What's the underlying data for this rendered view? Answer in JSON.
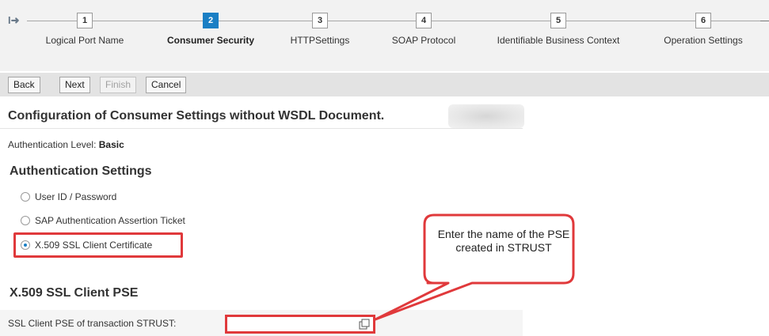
{
  "roadmap": {
    "steps": [
      {
        "number": "1",
        "label": "Logical Port Name",
        "active": false
      },
      {
        "number": "2",
        "label": "Consumer Security",
        "active": true
      },
      {
        "number": "3",
        "label": "HTTPSettings",
        "active": false
      },
      {
        "number": "4",
        "label": "SOAP Protocol",
        "active": false
      },
      {
        "number": "5",
        "label": "Identifiable Business Context",
        "active": false
      },
      {
        "number": "6",
        "label": "Operation Settings",
        "active": false
      }
    ],
    "start_icon": "roadmap-start-icon",
    "active_color": "#1a7fc4"
  },
  "toolbar": {
    "back_label": "Back",
    "next_label": "Next",
    "finish_label": "Finish",
    "cancel_label": "Cancel"
  },
  "main": {
    "title": "Configuration of Consumer Settings without WSDL Document.",
    "auth_level_label": "Authentication Level:",
    "auth_level_value": "Basic",
    "auth_settings_title": "Authentication Settings",
    "auth_options": [
      {
        "label": "User ID / Password",
        "selected": false
      },
      {
        "label": "SAP Authentication Assertion Ticket",
        "selected": false
      },
      {
        "label": "X.509 SSL Client Certificate",
        "selected": true
      }
    ],
    "pse_section_title": "X.509 SSL Client PSE",
    "pse_label": "SSL Client PSE of transaction STRUST:",
    "pse_value": ""
  },
  "callout": {
    "text": "Enter the name of the PSE created in STRUST",
    "color": "#e0393b"
  }
}
